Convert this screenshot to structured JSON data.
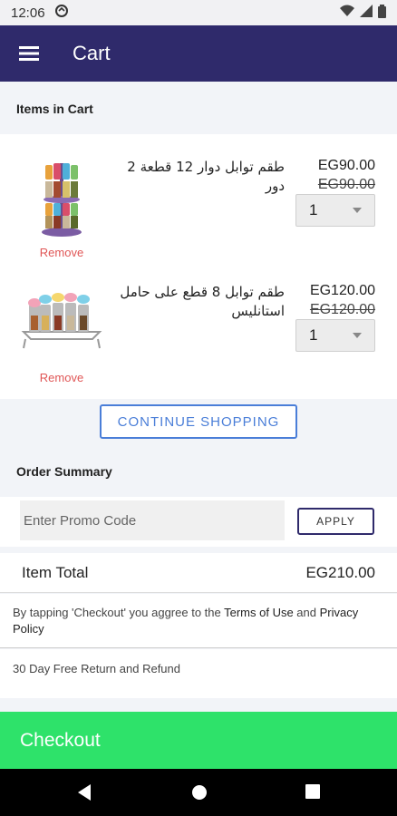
{
  "status_bar": {
    "time": "12:06"
  },
  "app_bar": {
    "title": "Cart"
  },
  "items_header": "Items in Cart",
  "items": [
    {
      "name": "طقم توابل دوار 12 قطعة 2 دور",
      "price": "EG90.00",
      "old_price": "EG90.00",
      "quantity": "1",
      "remove_label": "Remove"
    },
    {
      "name": "طقم توابل 8 قطع على حامل استانليس",
      "price": "EG120.00",
      "old_price": "EG120.00",
      "quantity": "1",
      "remove_label": "Remove"
    }
  ],
  "continue_label": "CONTINUE SHOPPING",
  "summary_header": "Order Summary",
  "promo": {
    "placeholder": "Enter Promo Code",
    "apply_label": "APPLY"
  },
  "item_total": {
    "label": "Item Total",
    "value": "EG210.00"
  },
  "terms": {
    "prefix": "By tapping 'Checkout' you aggree to the ",
    "terms_link": "Terms of Use",
    "middle": " and ",
    "privacy_link": "Privacy Policy"
  },
  "refund_text": "30 Day Free Return and Refund",
  "checkout_label": "Checkout",
  "colors": {
    "app_bar": "#2f2a6b",
    "checkout": "#2ee26a",
    "remove": "#e05656",
    "continue": "#4a7ed8"
  }
}
